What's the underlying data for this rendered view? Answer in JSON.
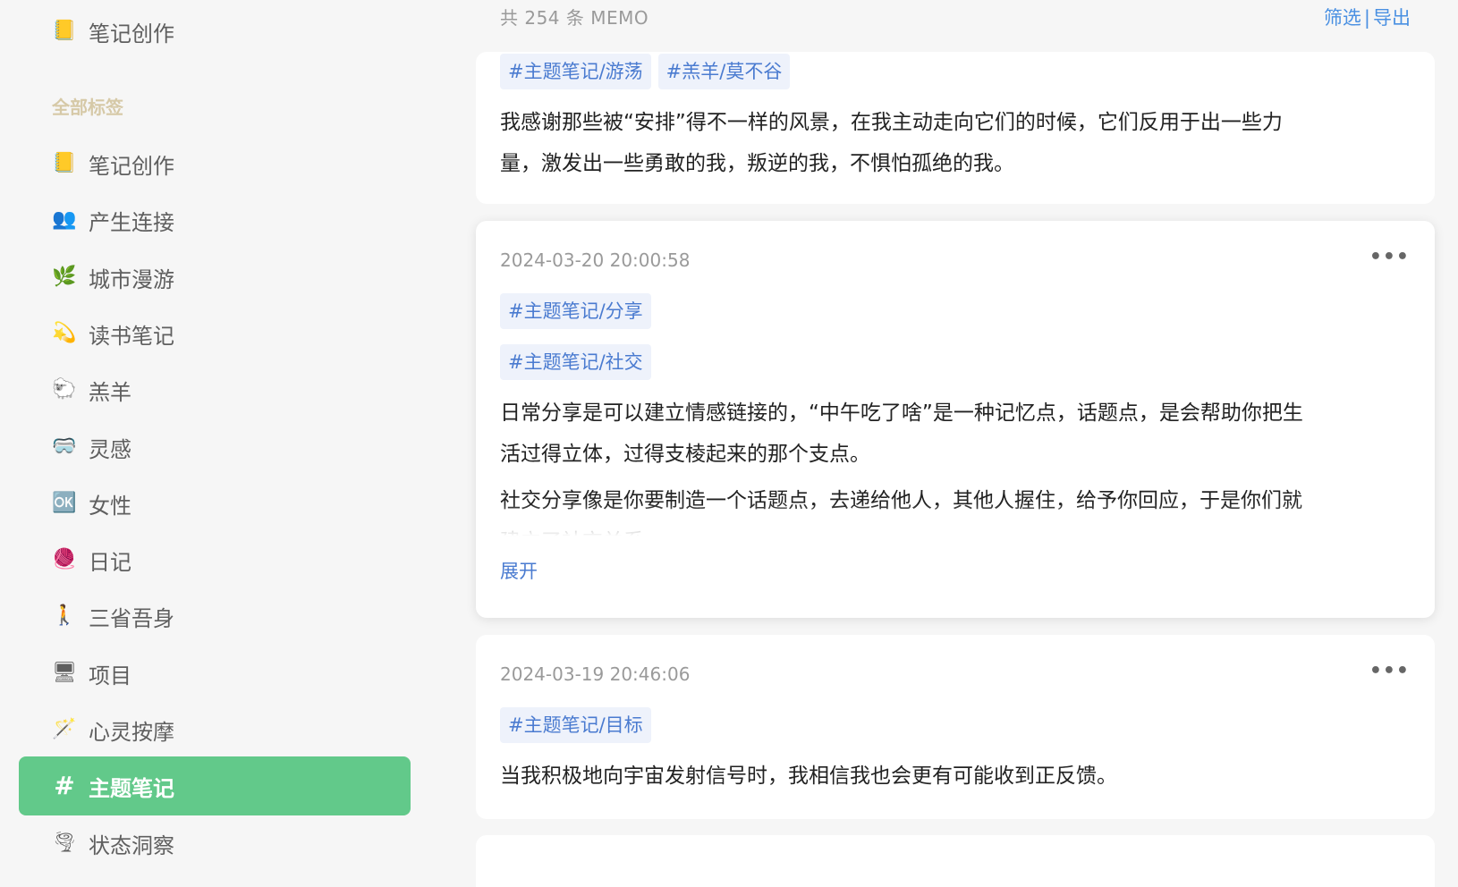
{
  "sidebar": {
    "top_item": {
      "icon": "notebook-icon",
      "glyph": "📒",
      "label": "笔记创作"
    },
    "section_label": "全部标签",
    "items": [
      {
        "icon": "notebook-icon",
        "glyph": "📒",
        "label": "笔记创作"
      },
      {
        "icon": "people-icon",
        "glyph": "👥",
        "label": "产生连接"
      },
      {
        "icon": "herb-icon",
        "glyph": "🌿",
        "label": "城市漫游"
      },
      {
        "icon": "dizzy-star-icon",
        "glyph": "💫",
        "label": "读书笔记"
      },
      {
        "icon": "sheep-icon",
        "glyph": "🐑",
        "label": "羔羊"
      },
      {
        "icon": "goggles-icon",
        "glyph": "🥽",
        "label": "灵感"
      },
      {
        "icon": "ok-button-icon",
        "glyph": "🆗",
        "label": "女性"
      },
      {
        "icon": "yarn-ball-icon",
        "glyph": "🧶",
        "label": "日记"
      },
      {
        "icon": "walking-person-icon",
        "glyph": "🚶",
        "label": "三省吾身"
      },
      {
        "icon": "desktop-computer-icon",
        "glyph": "🖥",
        "label": "项目"
      },
      {
        "icon": "magic-wand-icon",
        "glyph": "🪄",
        "label": "心灵按摩"
      },
      {
        "icon": "hash-icon",
        "glyph": "#",
        "label": "主题笔记",
        "active": true
      },
      {
        "icon": "tornado-icon",
        "glyph": "🌪",
        "label": "状态洞察"
      }
    ]
  },
  "header": {
    "count": "共 254 条 MEMO",
    "filter": "筛选",
    "separator": "|",
    "export": "导出"
  },
  "memos": [
    {
      "tags": [
        "#主题笔记/游荡",
        "#羔羊/莫不谷"
      ],
      "lines": [
        "我感谢那些被“安排”得不一样的风景，在我主动走向它们的时候，它们反用于出一些力",
        "量，激发出一些勇敢的我，叛逆的我，不惧怕孤绝的我。"
      ]
    },
    {
      "date": "2024-03-20 20:00:58",
      "more": "•••",
      "tags": [
        "#主题笔记/分享",
        "#主题笔记/社交"
      ],
      "lines": [
        "日常分享是可以建立情感链接的，“中午吃了啥”是一种记忆点，话题点，是会帮助你把生",
        "活过得立体，过得支棱起来的那个支点。"
      ],
      "faded": [
        "社交分享像是你要制造一个话题点，去递给他人，其他人握住，给予你回应，于是你们就",
        "建立了社交关系"
      ],
      "expand": "展开"
    },
    {
      "date": "2024-03-19 20:46:06",
      "more": "•••",
      "tags": [
        "#主题笔记/目标"
      ],
      "lines": [
        "当我积极地向宇宙发射信号时，我相信我也会更有可能收到正反馈。"
      ]
    }
  ]
}
